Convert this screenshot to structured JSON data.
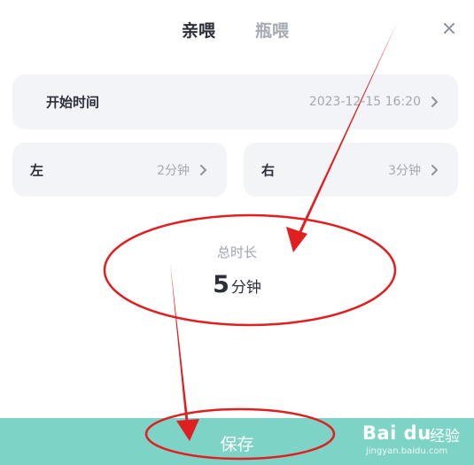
{
  "tabs": {
    "active": "亲喂",
    "inactive": "瓶喂"
  },
  "start_row": {
    "label": "开始时间",
    "value": "2023-12-15 16:20"
  },
  "left_row": {
    "label": "左",
    "value": "2分钟"
  },
  "right_row": {
    "label": "右",
    "value": "3分钟"
  },
  "total": {
    "label": "总时长",
    "number": "5",
    "unit": "分钟"
  },
  "save": {
    "label": "保存"
  },
  "watermark": {
    "logo": "Bai du",
    "text": "经验",
    "sub": "jingyan.baidu.com"
  },
  "colors": {
    "save_bar": "#7dd3c5",
    "annotation_red": "#e02020",
    "card_bg": "#f3f4f7",
    "text_dark": "#2b2f3a",
    "text_muted": "#a3a8b2"
  },
  "icons": {
    "close": "close-icon",
    "chevron": "chevron-right-icon"
  }
}
